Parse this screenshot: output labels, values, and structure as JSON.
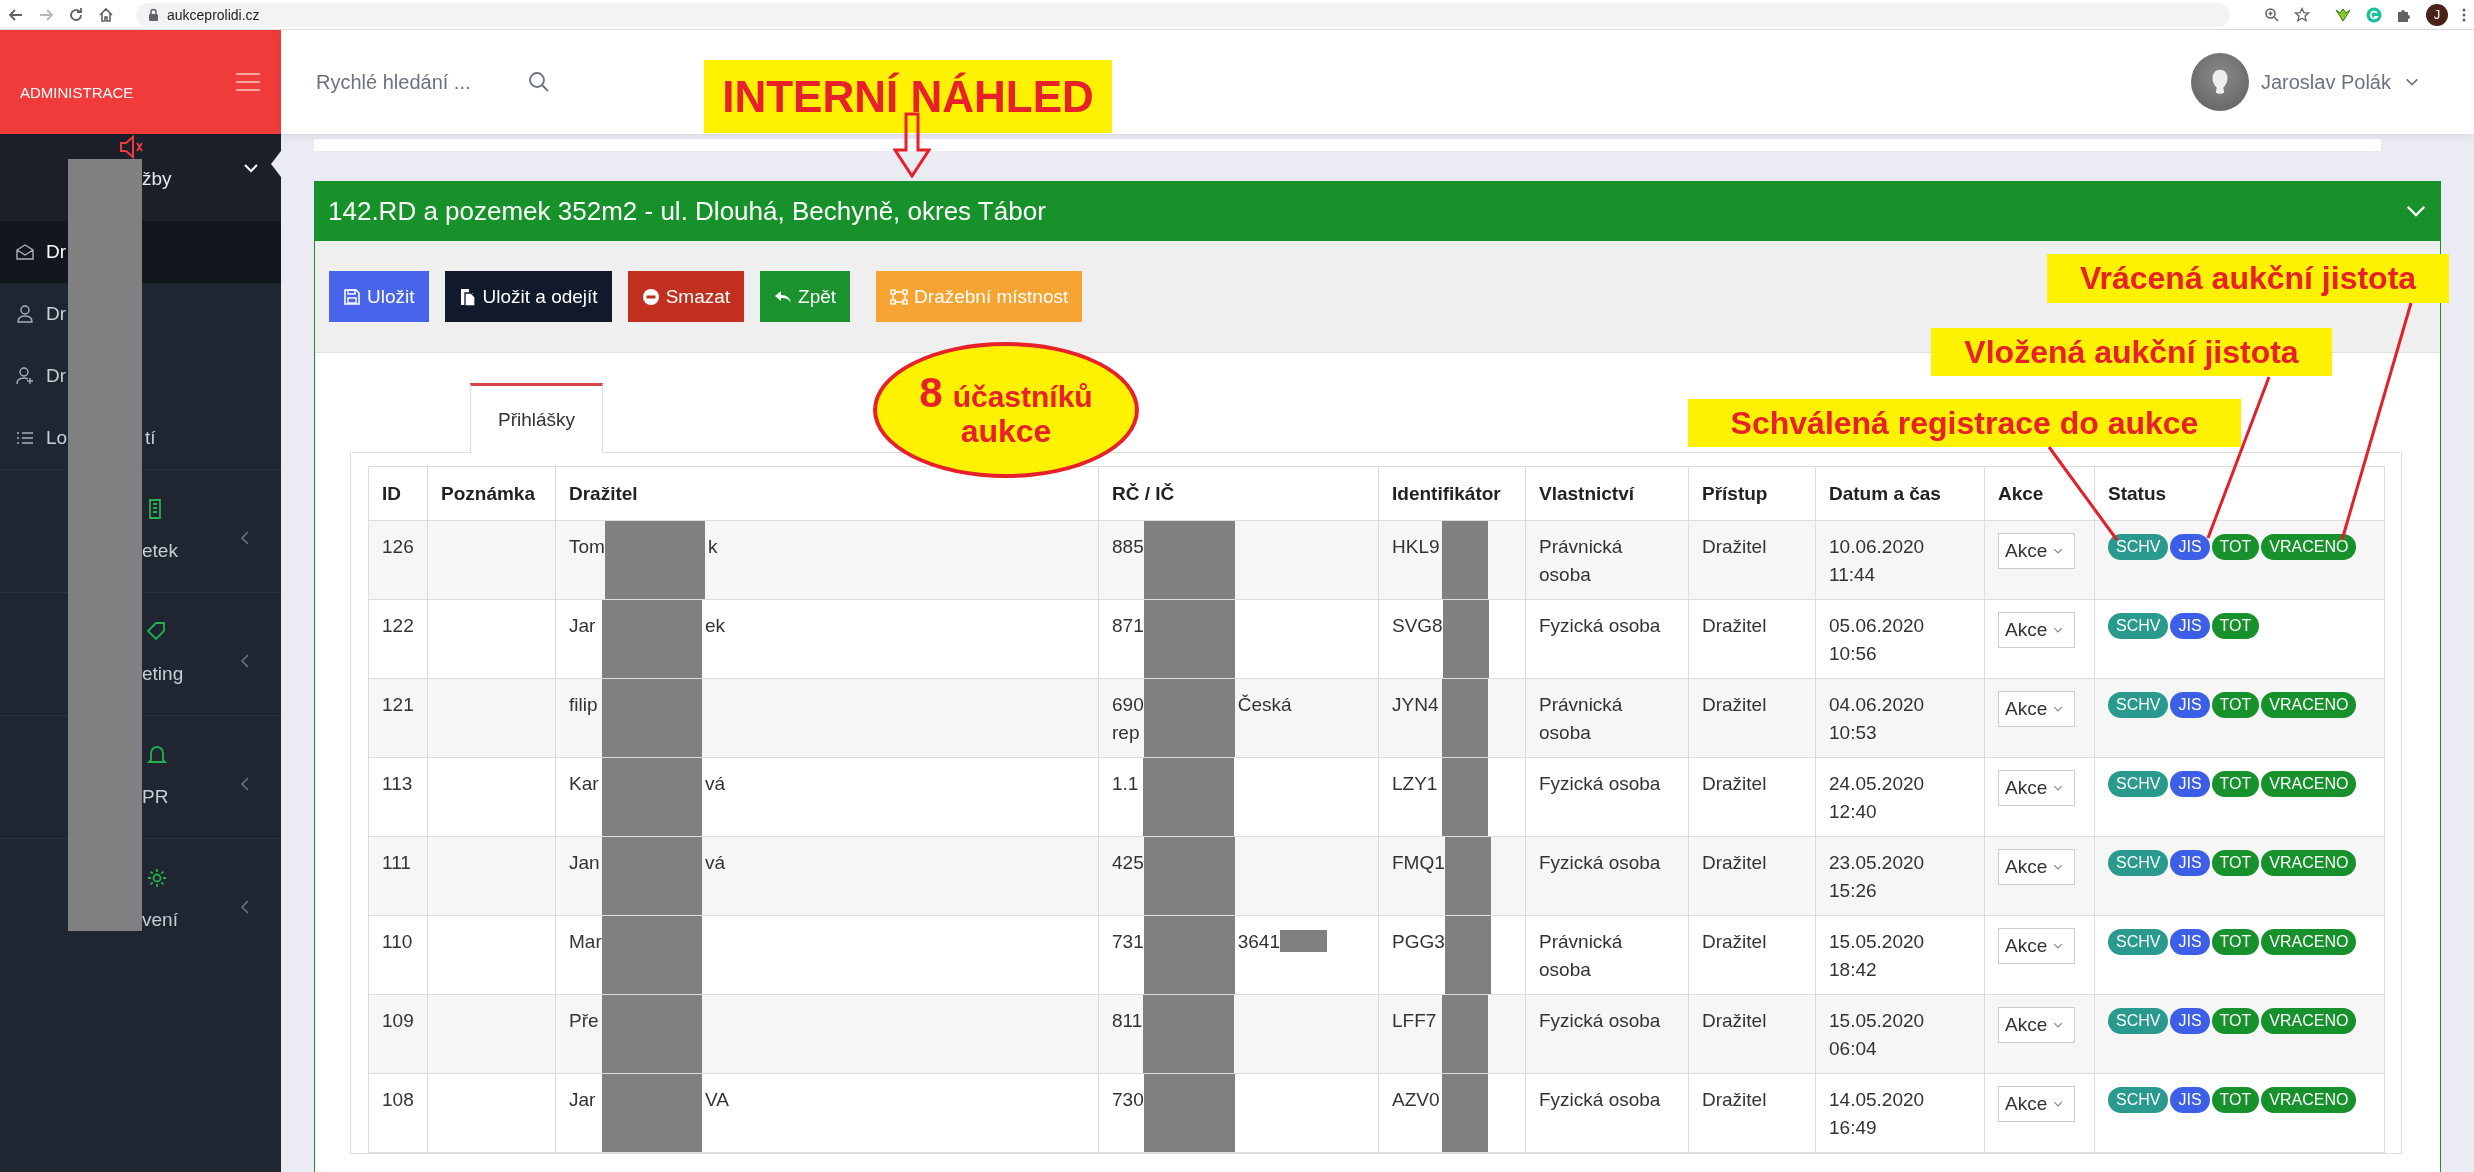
{
  "browser": {
    "url": "aukceprolidi.cz",
    "profile_initial": "J"
  },
  "sidebar": {
    "brand": "ADMINISTRACE",
    "dropdown": {
      "label": "žby",
      "expanded": true
    },
    "items": [
      {
        "label": "Dr",
        "selected": true
      },
      {
        "label": "Dr",
        "selected": false
      },
      {
        "label": "Dr",
        "selected": false
      },
      {
        "label": "Lo",
        "label_end": "tí",
        "selected": false
      }
    ],
    "sections": [
      {
        "label": "etek",
        "expanded": false
      },
      {
        "label": "eting",
        "expanded": false
      },
      {
        "label": "PR",
        "expanded": false
      },
      {
        "label": "vení",
        "expanded": false
      }
    ]
  },
  "header": {
    "search_placeholder": "Rychlé hledání ...",
    "user_name": "Jaroslav Polák"
  },
  "panel": {
    "title": "142.RD a pozemek 352m2 - ul. Dlouhá, Bechyně, okres Tábor",
    "expanded": true,
    "buttons": [
      {
        "label": "Uložit",
        "kind": "save"
      },
      {
        "label": "Uložit a odejít",
        "kind": "save-exit"
      },
      {
        "label": "Smazat",
        "kind": "delete"
      },
      {
        "label": "Zpět",
        "kind": "back"
      },
      {
        "label": "Dražební místnost",
        "kind": "room"
      }
    ],
    "tabs": [
      {
        "label": "Přihlášky",
        "selected": true
      }
    ],
    "table": {
      "columns": [
        "ID",
        "Poznámka",
        "Dražitel",
        "RČ / IČ",
        "Identifikátor",
        "Vlastnictví",
        "Přístup",
        "Datum a čas",
        "Akce",
        "Status"
      ],
      "rows": [
        {
          "id": "126",
          "bidder": {
            "start": "Tom",
            "end": "k"
          },
          "rc": {
            "start": "885",
            "end_redacted": false
          },
          "identifier": {
            "start": "HKL9"
          },
          "ownership": "Právnická osoba",
          "access": "Dražitel",
          "datetime": "10.06.2020 11:44",
          "action": "Akce",
          "status": [
            {
              "label": "SCHV",
              "color": "#2a9a8e"
            },
            {
              "label": "JIS",
              "color": "#3d5ee6"
            },
            {
              "label": "TOT",
              "color": "#16912b"
            },
            {
              "label": "VRACENO",
              "color": "#16912b"
            }
          ]
        },
        {
          "id": "122",
          "bidder": {
            "start": "Jar",
            "end": "ek"
          },
          "rc": {
            "start": "871",
            "end_redacted": false
          },
          "identifier": {
            "start": "SVG8"
          },
          "ownership": "Fyzická osoba",
          "access": "Dražitel",
          "datetime": "05.06.2020 10:56",
          "action": "Akce",
          "status": [
            {
              "label": "SCHV",
              "color": "#2a9a8e"
            },
            {
              "label": "JIS",
              "color": "#3d5ee6"
            },
            {
              "label": "TOT",
              "color": "#16912b"
            }
          ]
        },
        {
          "id": "121",
          "bidder": {
            "start": "filip"
          },
          "rc": {
            "start": "690\nrep",
            "end": "Česká",
            "end_redacted": false
          },
          "identifier": {
            "start": "JYN4"
          },
          "ownership": "Právnická osoba",
          "access": "Dražitel",
          "datetime": "04.06.2020 10:53",
          "action": "Akce",
          "status": [
            {
              "label": "SCHV",
              "color": "#2a9a8e"
            },
            {
              "label": "JIS",
              "color": "#3d5ee6"
            },
            {
              "label": "TOT",
              "color": "#16912b"
            },
            {
              "label": "VRACENO",
              "color": "#16912b"
            }
          ]
        },
        {
          "id": "113",
          "bidder": {
            "start": "Kar",
            "end": "vá"
          },
          "rc": {
            "start": "1.1",
            "end_redacted": false
          },
          "identifier": {
            "start": "LZY1"
          },
          "ownership": "Fyzická osoba",
          "access": "Dražitel",
          "datetime": "24.05.2020 12:40",
          "action": "Akce",
          "status": [
            {
              "label": "SCHV",
              "color": "#2a9a8e"
            },
            {
              "label": "JIS",
              "color": "#3d5ee6"
            },
            {
              "label": "TOT",
              "color": "#16912b"
            },
            {
              "label": "VRACENO",
              "color": "#16912b"
            }
          ]
        },
        {
          "id": "111",
          "bidder": {
            "start": "Jan",
            "end": "vá"
          },
          "rc": {
            "start": "425",
            "end_redacted": false
          },
          "identifier": {
            "start": "FMQ1"
          },
          "ownership": "Fyzická osoba",
          "access": "Dražitel",
          "datetime": "23.05.2020 15:26",
          "action": "Akce",
          "status": [
            {
              "label": "SCHV",
              "color": "#2a9a8e"
            },
            {
              "label": "JIS",
              "color": "#3d5ee6"
            },
            {
              "label": "TOT",
              "color": "#16912b"
            },
            {
              "label": "VRACENO",
              "color": "#16912b"
            }
          ]
        },
        {
          "id": "110",
          "bidder": {
            "start": "Mar"
          },
          "rc": {
            "start": "731",
            "end": "3641",
            "end_redacted": true
          },
          "identifier": {
            "start": "PGG3"
          },
          "ownership": "Právnická osoba",
          "access": "Dražitel",
          "datetime": "15.05.2020 18:42",
          "action": "Akce",
          "status": [
            {
              "label": "SCHV",
              "color": "#2a9a8e"
            },
            {
              "label": "JIS",
              "color": "#3d5ee6"
            },
            {
              "label": "TOT",
              "color": "#16912b"
            },
            {
              "label": "VRACENO",
              "color": "#16912b"
            }
          ]
        },
        {
          "id": "109",
          "bidder": {
            "start": "Pře"
          },
          "rc": {
            "start": "811",
            "end_redacted": false
          },
          "identifier": {
            "start": "LFF7"
          },
          "ownership": "Fyzická osoba",
          "access": "Dražitel",
          "datetime": "15.05.2020 06:04",
          "action": "Akce",
          "status": [
            {
              "label": "SCHV",
              "color": "#2a9a8e"
            },
            {
              "label": "JIS",
              "color": "#3d5ee6"
            },
            {
              "label": "TOT",
              "color": "#16912b"
            },
            {
              "label": "VRACENO",
              "color": "#16912b"
            }
          ]
        },
        {
          "id": "108",
          "bidder": {
            "start": "Jar",
            "end": "VA"
          },
          "rc": {
            "start": "730",
            "end_redacted": false
          },
          "identifier": {
            "start": "AZV0"
          },
          "ownership": "Fyzická osoba",
          "access": "Dražitel",
          "datetime": "14.05.2020 16:49",
          "action": "Akce",
          "status": [
            {
              "label": "SCHV",
              "color": "#2a9a8e"
            },
            {
              "label": "JIS",
              "color": "#3d5ee6"
            },
            {
              "label": "TOT",
              "color": "#16912b"
            },
            {
              "label": "VRACENO",
              "color": "#16912b"
            }
          ]
        }
      ]
    }
  },
  "annotations": {
    "preview_label": "INTERNÍ NÁHLED",
    "bubble": {
      "count": "8",
      "word": "účastníků",
      "line_2": "aukce"
    },
    "callouts": [
      "Vrácená aukční jistota",
      "Vložená aukční jistota",
      "Schválená registrace do aukce"
    ]
  }
}
